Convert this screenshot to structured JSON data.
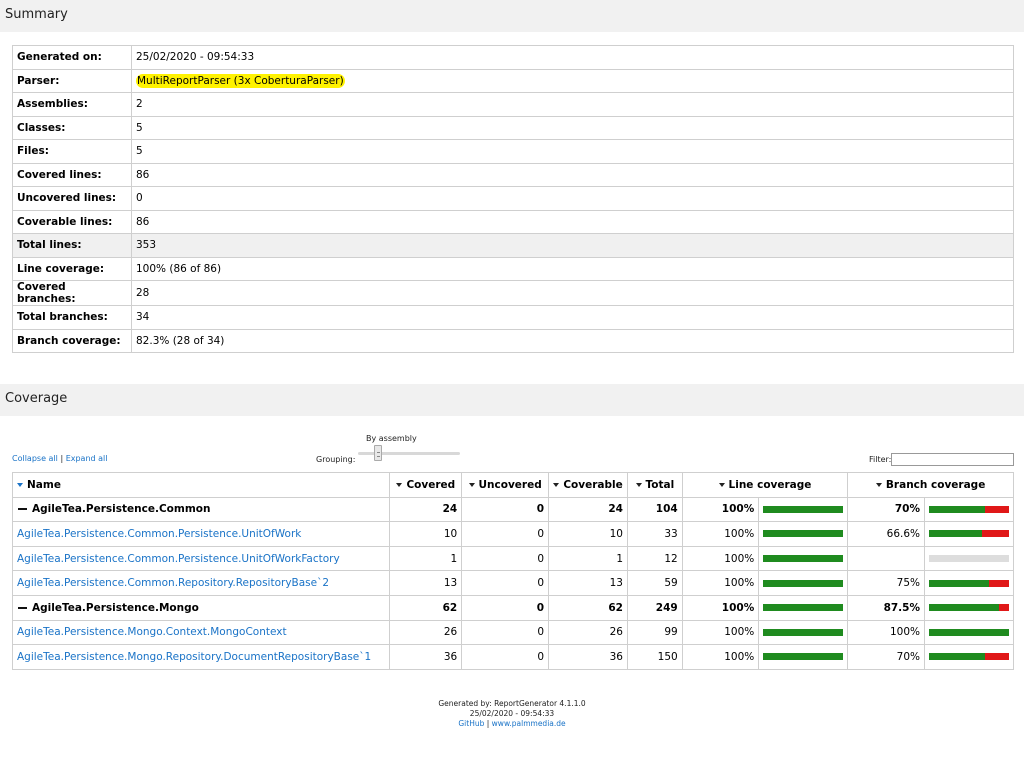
{
  "summary_header": "Summary",
  "summary": [
    {
      "key": "Generated on:",
      "value": "25/02/2020 - 09:54:33"
    },
    {
      "key": "Parser:",
      "value": "MultiReportParser (3x CoberturaParser)"
    },
    {
      "key": "Assemblies:",
      "value": "2"
    },
    {
      "key": "Classes:",
      "value": "5"
    },
    {
      "key": "Files:",
      "value": "5"
    },
    {
      "key": "Covered lines:",
      "value": "86"
    },
    {
      "key": "Uncovered lines:",
      "value": "0"
    },
    {
      "key": "Coverable lines:",
      "value": "86"
    },
    {
      "key": "Total lines:",
      "value": "353"
    },
    {
      "key": "Line coverage:",
      "value": "100% (86 of 86)"
    },
    {
      "key": "Covered branches:",
      "value": "28"
    },
    {
      "key": "Total branches:",
      "value": "34"
    },
    {
      "key": "Branch coverage:",
      "value": "82.3% (28 of 34)"
    }
  ],
  "coverage_header": "Coverage",
  "controls": {
    "collapse_all": "Collapse all",
    "separator": "|",
    "expand_all": "Expand all",
    "grouping_label": "Grouping:",
    "grouping_value": "By assembly",
    "filter_label": "Filter:",
    "filter_value": ""
  },
  "columns": {
    "name": "Name",
    "covered": "Covered",
    "uncovered": "Uncovered",
    "coverable": "Coverable",
    "total": "Total",
    "line_coverage": "Line coverage",
    "branch_coverage": "Branch coverage"
  },
  "rows": [
    {
      "name": "AgileTea.Persistence.Common",
      "group": true,
      "covered": "24",
      "uncovered": "0",
      "coverable": "24",
      "total": "104",
      "line_pct": "100%",
      "line_frac": 1.0,
      "branch_pct": "70%",
      "branch_frac": 0.7
    },
    {
      "name": "AgileTea.Persistence.Common.Persistence.UnitOfWork",
      "group": false,
      "covered": "10",
      "uncovered": "0",
      "coverable": "10",
      "total": "33",
      "line_pct": "100%",
      "line_frac": 1.0,
      "branch_pct": "66.6%",
      "branch_frac": 0.666
    },
    {
      "name": "AgileTea.Persistence.Common.Persistence.UnitOfWorkFactory",
      "group": false,
      "covered": "1",
      "uncovered": "0",
      "coverable": "1",
      "total": "12",
      "line_pct": "100%",
      "line_frac": 1.0,
      "branch_pct": "",
      "branch_frac": null
    },
    {
      "name": "AgileTea.Persistence.Common.Repository.RepositoryBase`2",
      "group": false,
      "covered": "13",
      "uncovered": "0",
      "coverable": "13",
      "total": "59",
      "line_pct": "100%",
      "line_frac": 1.0,
      "branch_pct": "75%",
      "branch_frac": 0.75
    },
    {
      "name": "AgileTea.Persistence.Mongo",
      "group": true,
      "covered": "62",
      "uncovered": "0",
      "coverable": "62",
      "total": "249",
      "line_pct": "100%",
      "line_frac": 1.0,
      "branch_pct": "87.5%",
      "branch_frac": 0.875
    },
    {
      "name": "AgileTea.Persistence.Mongo.Context.MongoContext",
      "group": false,
      "covered": "26",
      "uncovered": "0",
      "coverable": "26",
      "total": "99",
      "line_pct": "100%",
      "line_frac": 1.0,
      "branch_pct": "100%",
      "branch_frac": 1.0
    },
    {
      "name": "AgileTea.Persistence.Mongo.Repository.DocumentRepositoryBase`1",
      "group": false,
      "covered": "36",
      "uncovered": "0",
      "coverable": "36",
      "total": "150",
      "line_pct": "100%",
      "line_frac": 1.0,
      "branch_pct": "70%",
      "branch_frac": 0.7
    }
  ],
  "footer": {
    "generated_by": "Generated by: ReportGenerator 4.1.1.0",
    "date": "25/02/2020 - 09:54:33",
    "github": "GitHub",
    "sep": "|",
    "site": "www.palmmedia.de"
  },
  "colors": {
    "covered": "#1f8b1f",
    "uncovered": "#e01818",
    "link": "#1a73c7",
    "highlight": "#fff200"
  }
}
